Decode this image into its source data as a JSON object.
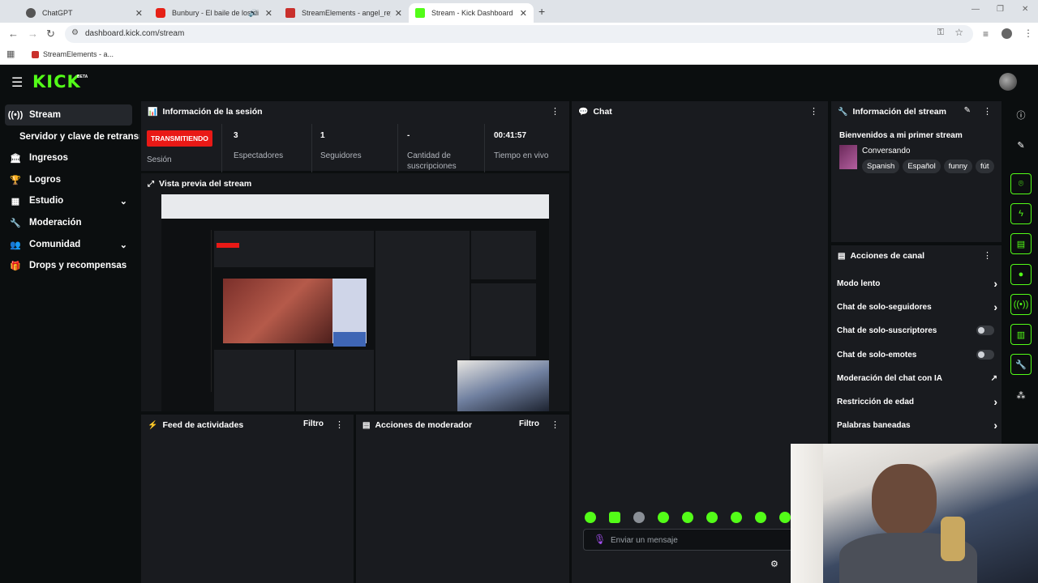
{
  "browser": {
    "tabs": [
      {
        "title": "ChatGPT"
      },
      {
        "title": "Bunbury - El baile de los di"
      },
      {
        "title": "StreamElements - angel_reyna"
      },
      {
        "title": "Stream - Kick Dashboard"
      }
    ],
    "url": "dashboard.kick.com/stream",
    "bookmark": "StreamElements - a..."
  },
  "app": {
    "logo": "KICK",
    "beta": "BETA"
  },
  "sidebar": {
    "items": [
      {
        "label": "Stream",
        "icon": "broadcast-icon"
      },
      {
        "label": "Servidor y clave de retransm"
      },
      {
        "label": "Ingresos",
        "icon": "bank-icon"
      },
      {
        "label": "Logros",
        "icon": "trophy-icon"
      },
      {
        "label": "Estudio",
        "icon": "grid-icon"
      },
      {
        "label": "Moderación",
        "icon": "wrench-icon"
      },
      {
        "label": "Comunidad",
        "icon": "people-icon"
      },
      {
        "label": "Drops y recompensas",
        "icon": "gift-icon"
      }
    ]
  },
  "session": {
    "title": "Información de la sesión",
    "live_badge": "TRANSMITIENDO",
    "session_label": "Sesión",
    "viewers_value": "3",
    "viewers_label": "Espectadores",
    "followers_value": "1",
    "followers_label": "Seguidores",
    "subs_value": "-",
    "subs_label": "Cantidad de suscripciones",
    "time_value": "00:41:57",
    "time_label": "Tiempo en vivo"
  },
  "preview": {
    "title": "Vista previa del stream"
  },
  "activity": {
    "title": "Feed de actividades",
    "filter": "Filtro"
  },
  "modactions": {
    "title": "Acciones de moderador",
    "filter": "Filtro"
  },
  "chat": {
    "title": "Chat",
    "placeholder": "Enviar un mensaje"
  },
  "streaminfo": {
    "title": "Información del stream",
    "stream_title": "Bienvenidos a mi primer stream",
    "category": "Conversando",
    "tags": [
      "Spanish",
      "Español",
      "funny",
      "fút"
    ]
  },
  "channel_actions": {
    "title": "Acciones de canal",
    "rows": [
      {
        "label": "Modo lento",
        "control": "chevron"
      },
      {
        "label": "Chat de solo-seguidores",
        "control": "chevron"
      },
      {
        "label": "Chat de solo-suscriptores",
        "control": "toggle"
      },
      {
        "label": "Chat de solo-emotes",
        "control": "toggle"
      },
      {
        "label": "Moderación del chat con IA",
        "control": "external"
      },
      {
        "label": "Restricción de edad",
        "control": "chevron"
      },
      {
        "label": "Palabras baneadas",
        "control": "chevron"
      }
    ]
  },
  "colors": {
    "accent": "#53fc18",
    "live": "#e91916",
    "panel": "#191b1f",
    "background": "#0b0e0f"
  }
}
